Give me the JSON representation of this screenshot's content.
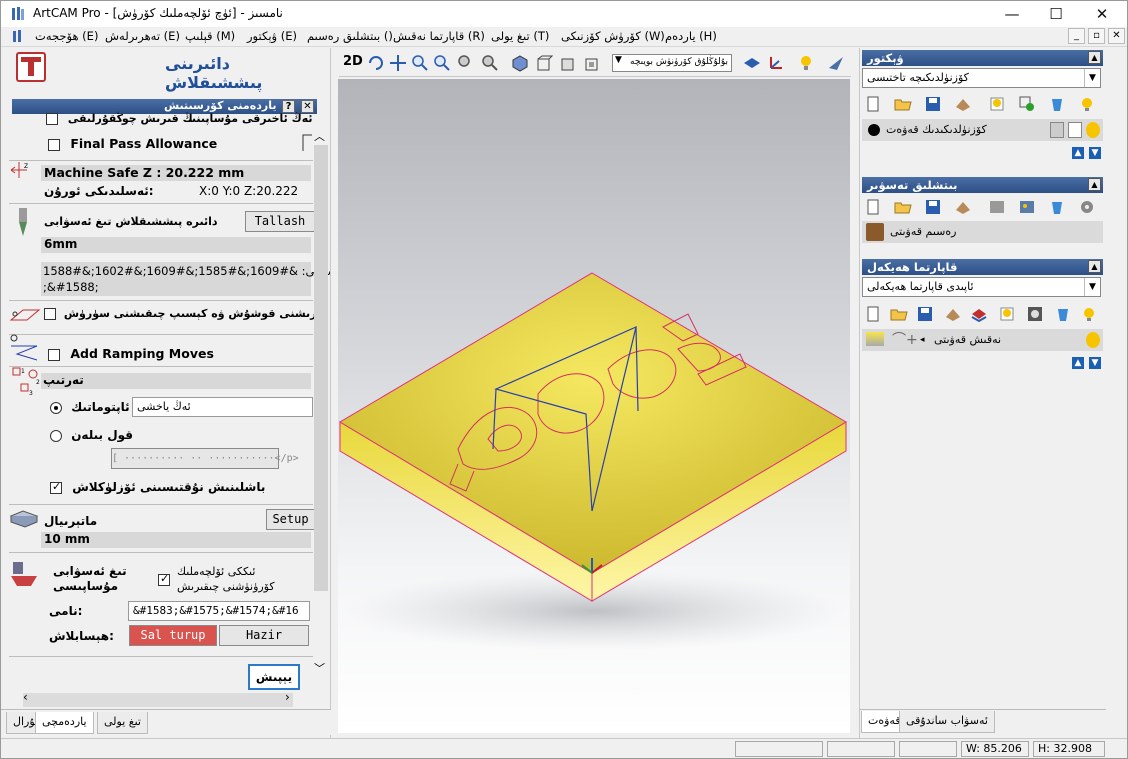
{
  "window": {
    "title": "ArtCAM Pro - [ئۈچ ئۆلچەملىك كۆرۈش] - نامسىز",
    "minimize": "—",
    "maximize": "☐",
    "close": "✕"
  },
  "menu": {
    "items": [
      "ھۆججەت (E)",
      "تەھرىرلەش (E)",
      "قېلىپ (M)",
      "ۋېكتور (E)",
      "بىتشلىق رەسىم ()",
      "قاپارتما نەقىش (R)",
      "تىغ يولى (T)",
      "كۆرۈش كۆزنىكى (W)",
      "ياردەم (H)"
    ],
    "mdi": [
      "_",
      "▫",
      "✕"
    ]
  },
  "left": {
    "title": "دائىرىنى پىششىقلاش",
    "float_title": "ياردەمنى كۆرسىتىش",
    "float_help": "?",
    "float_close": "✕",
    "opt_top": "ئەڭ ئاخىرقى مۇساپىنىڭ قىرىش چوڭقۇرلىقى",
    "final_pass": "Final Pass Allowance",
    "safe_z": "Machine Safe Z : 20.222 mm",
    "home_label": "ئەسلىدىكى ئورۇن:",
    "home_value": "X:0 Y:0 Z:20.222",
    "tool_label": "دائىرە پىششىقلاش تىغ ئەسۋابى",
    "tool_button": "Tallash",
    "tool_value": "6mm",
    "tool_desc": "قىرىش ئۇسۇلى: &#1609;&#1585;&#1609;&#1602;&#1588;",
    "tool_desc2": ";&#1588;",
    "vector_order": "ۋېكتور كىرىشنى قوشۇش ۋە كېسىپ چىقىشنى سۈرۈش",
    "ramping": "Add Ramping Moves",
    "order_header": "تەرتىپ",
    "auto": "ئاپتوماتىك",
    "auto_value": "ئەڭ ياخشى",
    "manual": "قول بىلەن",
    "manual_btn": "[ ·········· ·· ···········</p>",
    "corners": "باشلىنىش نۇقتىسىنى ئۆزلۈكلاش",
    "material": "ماتېرىيال",
    "material_btn": "Setup",
    "material_value": "10 mm",
    "toolpath_label": "تىغ ئەسۋابى مۇساپىسى",
    "show_label": "ئىككى ئۆلچەملىك كۆرۈنۈشنى چىقىرىش",
    "name_label": "نامى:",
    "name_value": "&#1583;&#1575;&#1574;&#16",
    "calc_label": "ھېسابلاش:",
    "later_btn": "Sal turup",
    "now_btn": "Hazir",
    "close_btn": "يېپىش"
  },
  "left_tabs": [
    "قۇرال",
    "ياردەمچى",
    "تىغ يولى"
  ],
  "center": {
    "mode_2d": "2D",
    "view_select": "بۇلۇڭلۇق كۆرۈنۈش بويىچە"
  },
  "right": {
    "vector": {
      "title": "ۋېكتور",
      "dropdown": "كۆزنۈلدىكىچە تاختىسى",
      "layer": "كۆزنۈلدىكىدىك قەۋەت"
    },
    "bitmap": {
      "title": "بىتشلىق تەسۋىر",
      "layer": "رەسىم قەۋىتى"
    },
    "relief": {
      "title": "قاپارتما ھەيكەل",
      "dropdown": "ئاپىدى قاپارتما ھەيكەلى",
      "layer": "نەقىش قەۋىتى"
    },
    "tabs": [
      "قەۋەت",
      "ئەسۋاب ساندۇقى"
    ]
  },
  "status": {
    "w": "W: 85.206",
    "h": "H: 32.908"
  },
  "colors": {
    "accent": "#2c4f86",
    "relief": "#e8d83a",
    "outline": "#e0307a",
    "toolpath": "#2a3fb0",
    "button_red": "#d9534f"
  }
}
